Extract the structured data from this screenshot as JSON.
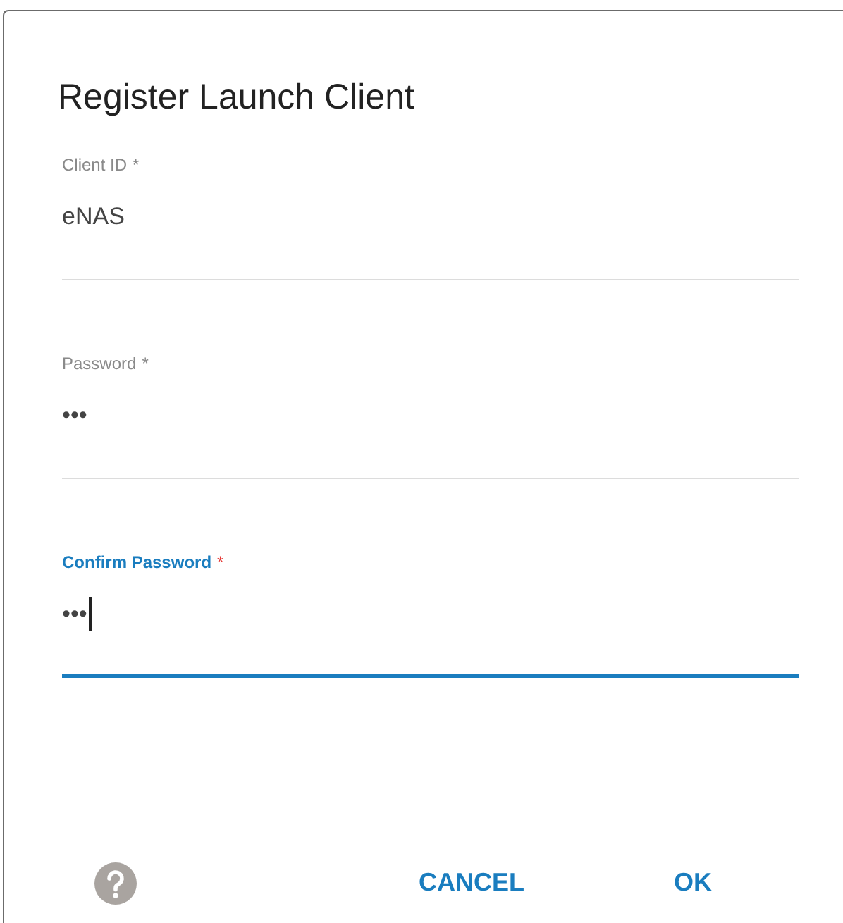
{
  "dialog": {
    "title": "Register Launch Client",
    "fields": [
      {
        "label": "Client ID",
        "required_mark": "*",
        "value": "eNAS",
        "focused": false
      },
      {
        "label": "Password",
        "required_mark": "*",
        "value": "•••",
        "focused": false
      },
      {
        "label": "Confirm Password",
        "required_mark": "*",
        "value": "•••",
        "focused": true
      }
    ],
    "buttons": [
      {
        "label": "CANCEL"
      },
      {
        "label": "OK"
      }
    ]
  }
}
